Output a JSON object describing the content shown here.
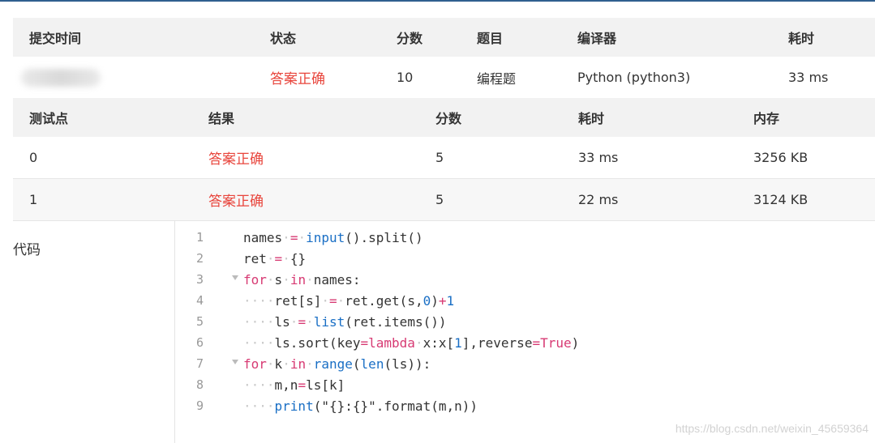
{
  "submission_table": {
    "headers": [
      "提交时间",
      "状态",
      "分数",
      "题目",
      "编译器",
      "耗时"
    ],
    "row": {
      "status": "答案正确",
      "score": "10",
      "problem": "编程题",
      "compiler": "Python (python3)",
      "time": "33 ms"
    }
  },
  "test_table": {
    "headers": [
      "测试点",
      "结果",
      "分数",
      "耗时",
      "内存"
    ],
    "rows": [
      {
        "point": "0",
        "result": "答案正确",
        "score": "5",
        "time": "33 ms",
        "memory": "3256 KB"
      },
      {
        "point": "1",
        "result": "答案正确",
        "score": "5",
        "time": "22 ms",
        "memory": "3124 KB"
      }
    ]
  },
  "code": {
    "label": "代码",
    "line_numbers": [
      "1",
      "2",
      "3",
      "4",
      "5",
      "6",
      "7",
      "8",
      "9"
    ],
    "lines": [
      "names = input().split()",
      "ret = {}",
      "for s in names:",
      "    ret[s] = ret.get(s,0)+1",
      "    ls = list(ret.items())",
      "    ls.sort(key=lambda x:x[1],reverse=True)",
      "for k in range(len(ls)):",
      "    m,n=ls[k]",
      "    print(\"{}:{}\".format(m,n))"
    ]
  },
  "watermark": "https://blog.csdn.net/weixin_45659364",
  "colors": {
    "accepted": "#e8453c",
    "keyword": "#d73a73",
    "builtin": "#1a6fc5",
    "header_bg": "#f2f2f2",
    "top_border": "#2f5f8f"
  }
}
